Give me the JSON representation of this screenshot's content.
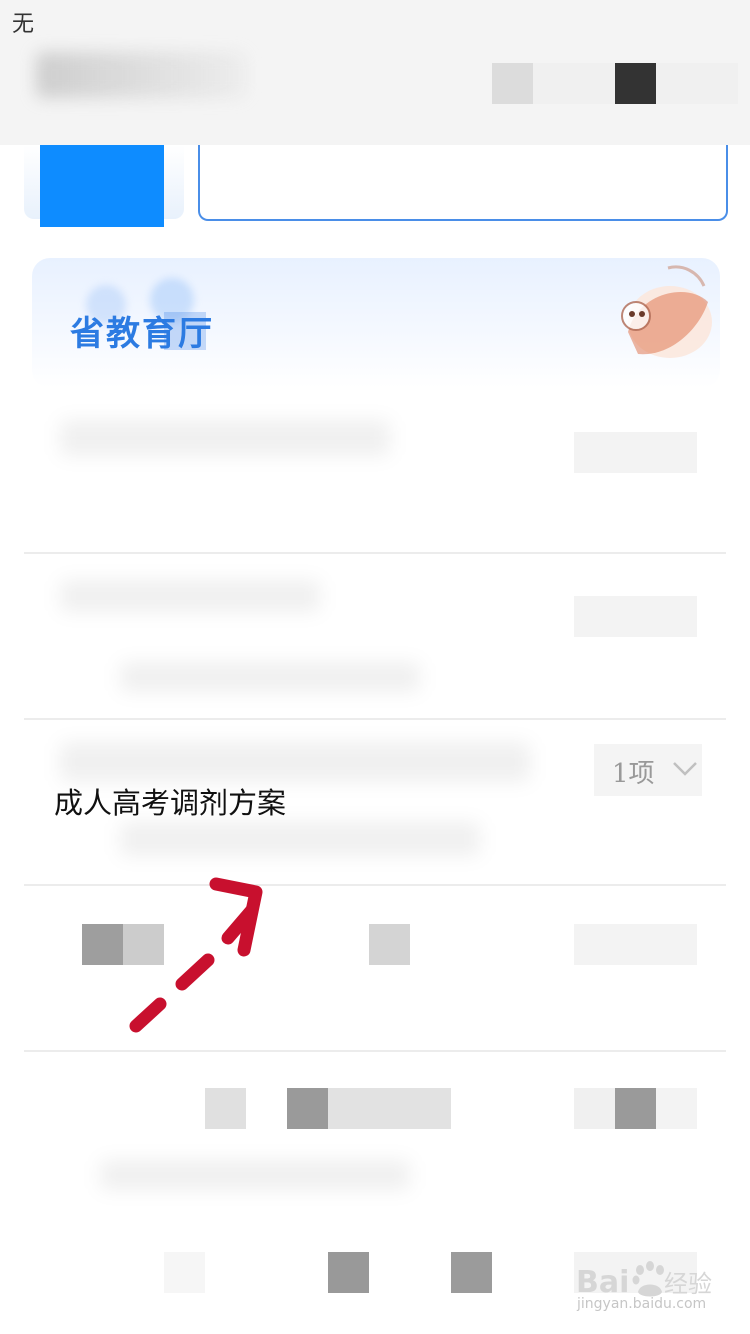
{
  "status_bar": {
    "text": "无"
  },
  "banner": {
    "title": "省教育厅"
  },
  "list": {
    "dropdown_value": "1项",
    "row_label": "成人高考调剂方案"
  },
  "watermark": {
    "brand": "Baidu经验",
    "url": "jingyan.baidu.com"
  },
  "colors": {
    "accent": "#2c7be2",
    "brand_blue": "#0e8cff",
    "arrow_red": "#c8102e"
  }
}
